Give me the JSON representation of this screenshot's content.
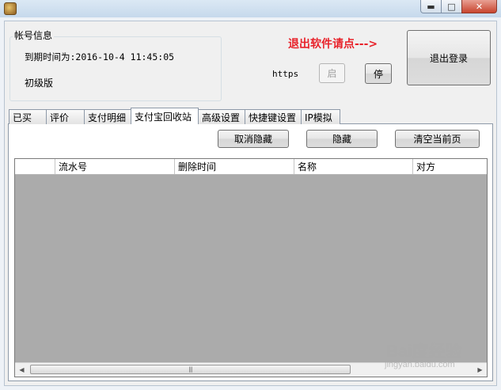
{
  "window": {
    "min_glyph": "▬",
    "max_glyph": "□",
    "close_glyph": "✕",
    "icon": "app-logo-icon"
  },
  "account": {
    "group_title": "帐号信息",
    "expire_text": "到期时间为:2016-10-4 11:45:05",
    "edition": "初级版"
  },
  "exit_hint": "退出软件请点--->",
  "protocol": {
    "label": "https",
    "start_label": "启",
    "start_enabled": false,
    "stop_label": "停"
  },
  "logout_label": "退出登录",
  "tabs": [
    {
      "label": "已买",
      "active": false
    },
    {
      "label": "评价",
      "active": false
    },
    {
      "label": "支付明细",
      "active": false
    },
    {
      "label": "支付宝回收站",
      "active": true
    },
    {
      "label": "高级设置",
      "active": false
    },
    {
      "label": "快捷键设置",
      "active": false
    },
    {
      "label": "IP模拟",
      "active": false
    }
  ],
  "actions": {
    "unhide": "取消隐藏",
    "hide": "隐藏",
    "clear_page": "清空当前页"
  },
  "table": {
    "columns": [
      "流水号",
      "删除时间",
      "名称",
      "对方"
    ],
    "rows": []
  },
  "scrollbar": {
    "left": "◀",
    "right": "▶",
    "grip": "|||"
  },
  "watermark": {
    "brand": "Bai度经验",
    "url": "jingyan.baidu.com"
  }
}
